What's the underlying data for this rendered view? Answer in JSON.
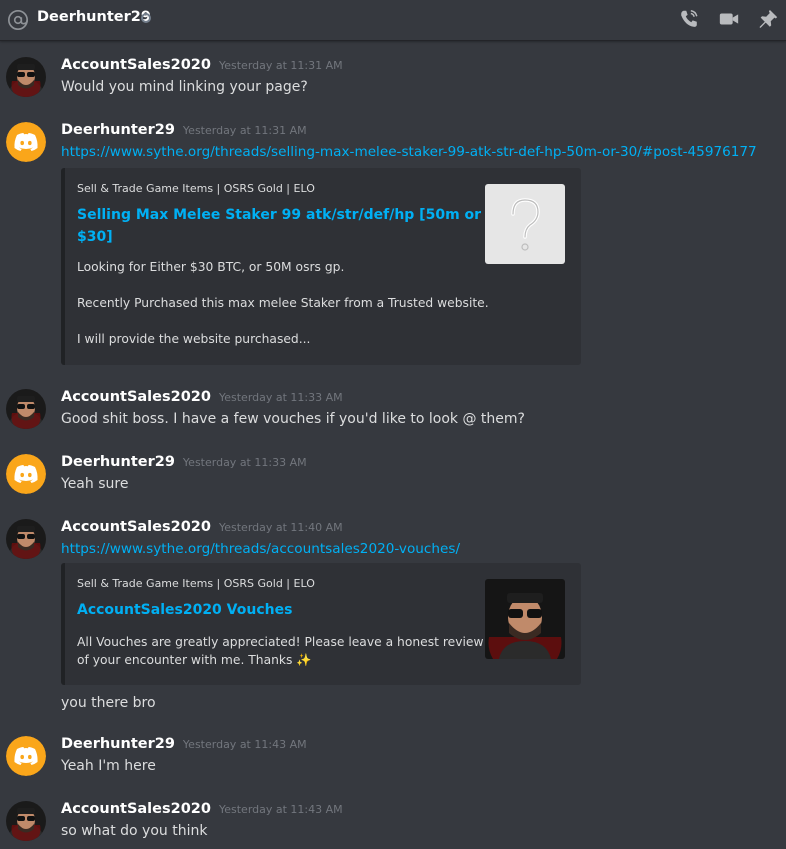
{
  "header": {
    "title": "Deerhunter29"
  },
  "users": {
    "a": "AccountSales2020",
    "d": "Deerhunter29"
  },
  "messages": [
    {
      "timestamp": "Yesterday at 11:31 AM",
      "text": "Would you mind linking your page?"
    },
    {
      "timestamp": "Yesterday at 11:31 AM",
      "link": "https://www.sythe.org/threads/selling-max-melee-staker-99-atk-str-def-hp-50m-or-30/#post-45976177",
      "embed": {
        "provider": "Sell & Trade Game Items | OSRS Gold | ELO",
        "title_line1": "Selling Max Melee Staker 99 atk/str/def/hp [50m or",
        "title_line2": "$30]",
        "desc1": "Looking for Either $30 BTC, or 50M osrs gp.",
        "desc2": "Recently Purchased this max melee Staker from a Trusted website.",
        "desc3": "I will provide the website purchased..."
      }
    },
    {
      "timestamp": "Yesterday at 11:33 AM",
      "text": "Good shit boss. I have a few vouches if you'd like to look @ them?"
    },
    {
      "timestamp": "Yesterday at 11:33 AM",
      "text": "Yeah sure"
    },
    {
      "timestamp": "Yesterday at 11:40 AM",
      "link": "https://www.sythe.org/threads/accountsales2020-vouches/",
      "embed": {
        "provider": "Sell & Trade Game Items | OSRS Gold | ELO",
        "title": "AccountSales2020 Vouches",
        "desc1": "All Vouches are greatly appreciated! Please leave a honest review",
        "desc2": "of your encounter with me. Thanks ✨"
      },
      "followup": "you there bro"
    },
    {
      "timestamp": "Yesterday at 11:43 AM",
      "text": "Yeah I'm here"
    },
    {
      "timestamp": "Yesterday at 11:43 AM",
      "text": "so what do you think"
    }
  ],
  "colors": {
    "background": "#36393f",
    "link": "#00b0f4",
    "discord_brand": "#faa61a",
    "embed_bg": "#2f3136"
  },
  "icons": [
    "at-icon",
    "status-icon",
    "phone-call-icon",
    "video-camera-icon",
    "pin-icon",
    "discord-logo-icon",
    "question-mark-icon"
  ]
}
